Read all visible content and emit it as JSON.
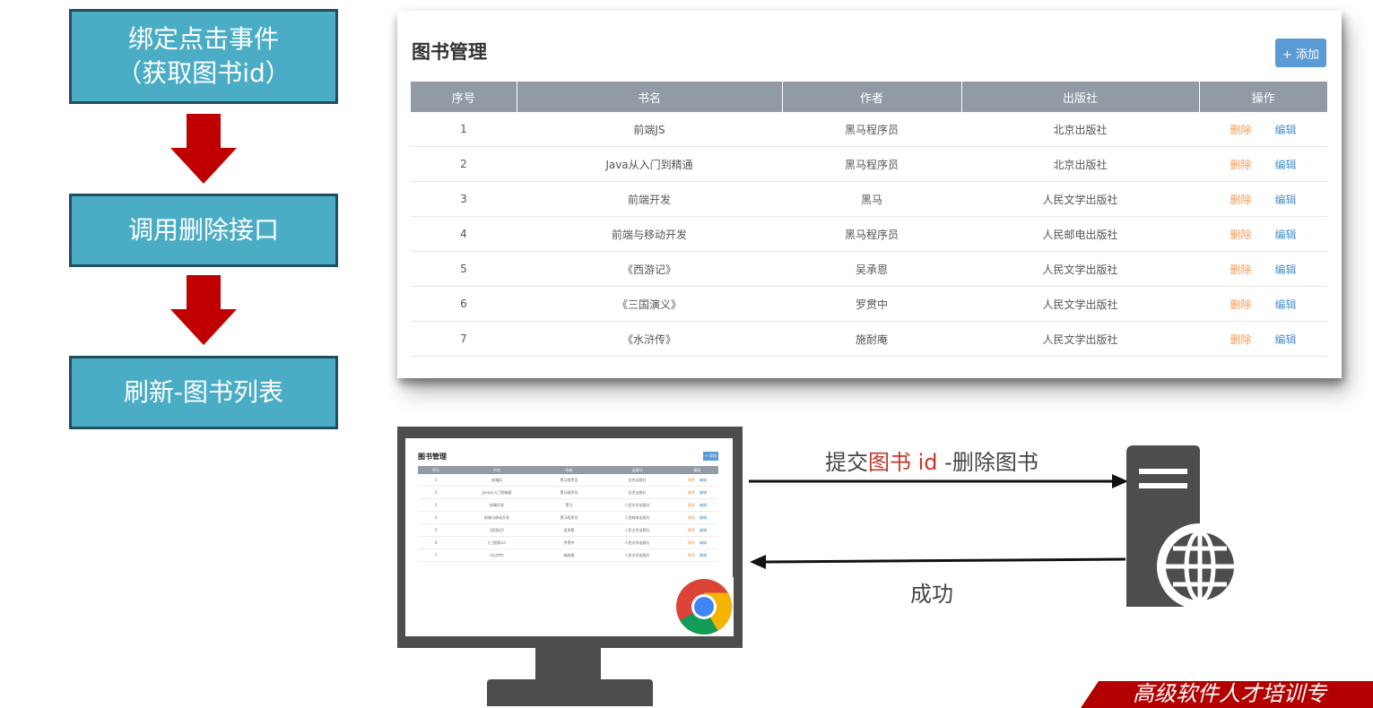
{
  "flow_steps": [
    {
      "line1": "绑定点击事件",
      "line2": "（获取图书id）"
    },
    {
      "line1": "调用删除接口"
    },
    {
      "line1": "刷新-图书列表"
    }
  ],
  "book_panel": {
    "title": "图书管理",
    "add_button": "+ 添加",
    "columns": [
      "序号",
      "书名",
      "作者",
      "出版社",
      "操作"
    ],
    "rows": [
      {
        "id": "1",
        "name": "前端JS",
        "author": "黑马程序员",
        "publisher": "北京出版社"
      },
      {
        "id": "2",
        "name": "Java从入门到精通",
        "author": "黑马程序员",
        "publisher": "北京出版社"
      },
      {
        "id": "3",
        "name": "前端开发",
        "author": "黑马",
        "publisher": "人民文学出版社"
      },
      {
        "id": "4",
        "name": "前端与移动开发",
        "author": "黑马程序员",
        "publisher": "人民邮电出版社"
      },
      {
        "id": "5",
        "name": "《西游记》",
        "author": "吴承恩",
        "publisher": "人民文学出版社"
      },
      {
        "id": "6",
        "name": "《三国演义》",
        "author": "罗贯中",
        "publisher": "人民文学出版社"
      },
      {
        "id": "7",
        "name": "《水浒传》",
        "author": "施耐庵",
        "publisher": "人民文学出版社"
      }
    ],
    "delete_label": "删除",
    "edit_label": "编辑"
  },
  "request": {
    "prefix": "提交",
    "highlight": "图书 id",
    "suffix": " -删除图书"
  },
  "response": {
    "label": "成功"
  },
  "banner_text": "高级软件人才培训专",
  "colors": {
    "flow_box": "#4bacc6",
    "arrow": "#c00000",
    "table_header": "#929ba5",
    "delete": "#f29b55",
    "edit": "#4a90c8"
  },
  "icons": {
    "browser": "chrome-icon",
    "server": "web-server-icon"
  }
}
